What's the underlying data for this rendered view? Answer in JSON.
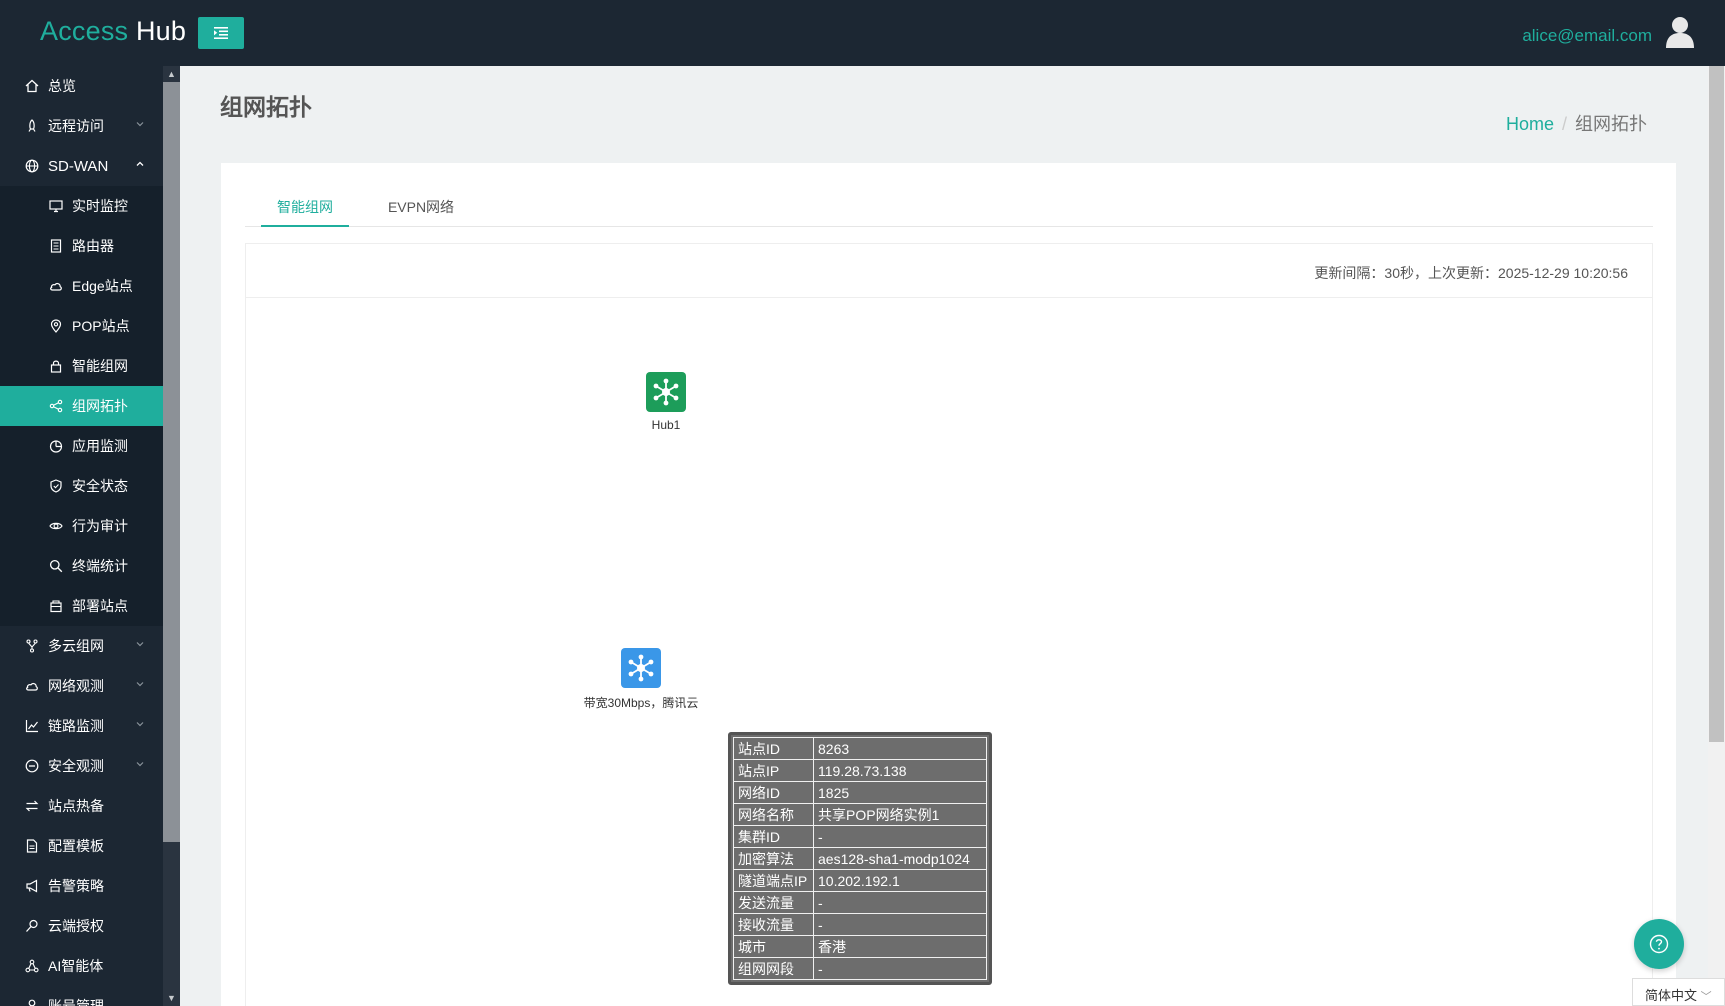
{
  "header": {
    "brand_part1": "Access",
    "brand_part2": "Hub",
    "user_email": "alice@email.com"
  },
  "sidebar": {
    "items": [
      {
        "label": "总览",
        "icon": "home-icon"
      },
      {
        "label": "远程访问",
        "icon": "rocket-icon"
      },
      {
        "label": "SD-WAN",
        "icon": "globe-icon"
      },
      {
        "label": "实时监控",
        "icon": "monitor-icon"
      },
      {
        "label": "路由器",
        "icon": "router-icon"
      },
      {
        "label": "Edge站点",
        "icon": "cloud-icon"
      },
      {
        "label": "POP站点",
        "icon": "location-pin-icon"
      },
      {
        "label": "智能组网",
        "icon": "lock-icon"
      },
      {
        "label": "组网拓扑",
        "icon": "share-icon"
      },
      {
        "label": "应用监测",
        "icon": "pie-chart-icon"
      },
      {
        "label": "安全状态",
        "icon": "shield-icon"
      },
      {
        "label": "行为审计",
        "icon": "eye-icon"
      },
      {
        "label": "终端统计",
        "icon": "search-icon"
      },
      {
        "label": "部署站点",
        "icon": "package-icon"
      },
      {
        "label": "多云组网",
        "icon": "branch-icon"
      },
      {
        "label": "网络观测",
        "icon": "cloud-icon"
      },
      {
        "label": "链路监测",
        "icon": "line-chart-icon"
      },
      {
        "label": "安全观测",
        "icon": "minus-circle-icon"
      },
      {
        "label": "站点热备",
        "icon": "swap-icon"
      },
      {
        "label": "配置模板",
        "icon": "file-icon"
      },
      {
        "label": "告警策略",
        "icon": "megaphone-icon"
      },
      {
        "label": "云端授权",
        "icon": "key-icon"
      },
      {
        "label": "AI智能体",
        "icon": "ai-icon"
      },
      {
        "label": "账号管理",
        "icon": "user-icon"
      }
    ]
  },
  "page": {
    "title": "组网拓扑",
    "breadcrumb_home": "Home",
    "breadcrumb_current": "组网拓扑"
  },
  "tabs": [
    {
      "label": "智能组网",
      "active": true
    },
    {
      "label": "EVPN网络",
      "active": false
    }
  ],
  "update_info": "更新间隔：30秒，上次更新：2025-12-29 10:20:56",
  "topology": {
    "nodes": [
      {
        "label": "Hub1",
        "color": "#1d9d5a"
      },
      {
        "label": "带宽30Mbps，腾讯云",
        "color": "#3a97e8"
      }
    ]
  },
  "tooltip": {
    "rows": [
      {
        "key": "站点ID",
        "value": "8263"
      },
      {
        "key": "站点IP",
        "value": "119.28.73.138"
      },
      {
        "key": "网络ID",
        "value": "1825"
      },
      {
        "key": "网络名称",
        "value": "共享POP网络实例1"
      },
      {
        "key": "集群ID",
        "value": "-"
      },
      {
        "key": "加密算法",
        "value": "aes128-sha1-modp1024"
      },
      {
        "key": "隧道端点IP",
        "value": "10.202.192.1"
      },
      {
        "key": "发送流量",
        "value": "-"
      },
      {
        "key": "接收流量",
        "value": "-"
      },
      {
        "key": "城市",
        "value": "香港"
      },
      {
        "key": "组网网段",
        "value": "-"
      }
    ]
  },
  "language": "简体中文",
  "colors": {
    "accent": "#1fae9d",
    "sidebar_bg": "#1c2733",
    "hub_node": "#1d9d5a",
    "edge_node": "#3a97e8"
  }
}
